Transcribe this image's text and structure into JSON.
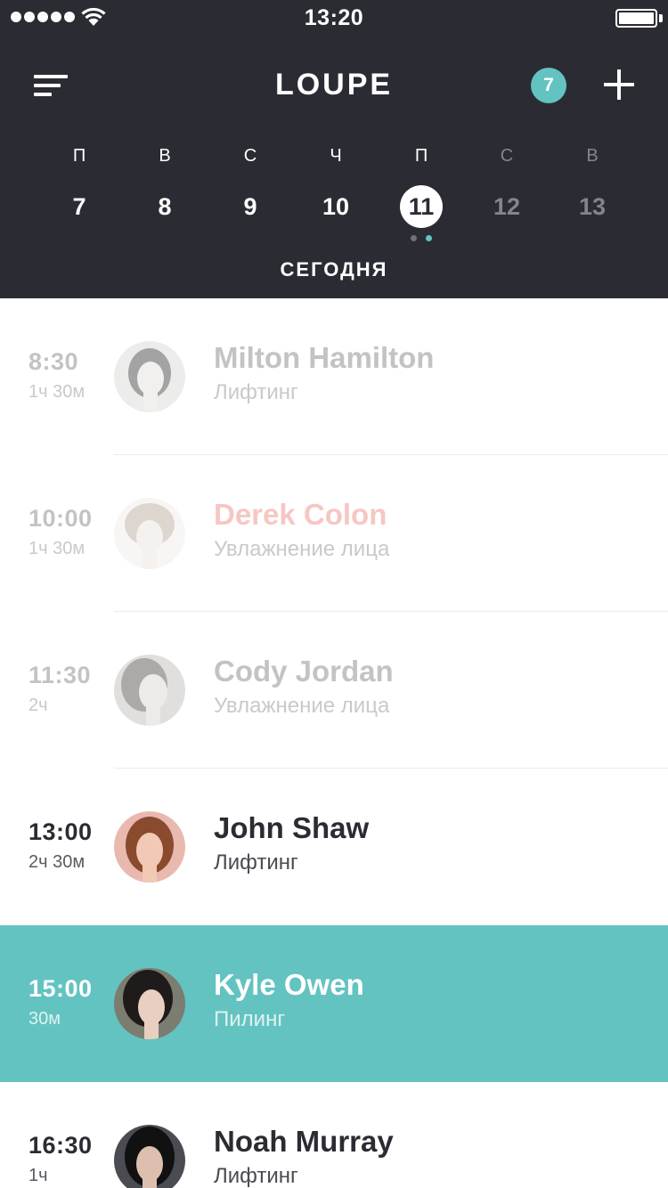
{
  "status_bar": {
    "time": "13:20"
  },
  "header": {
    "app_title": "LOUPE",
    "notification_count": "7",
    "today_label": "СЕГОДНЯ"
  },
  "week": {
    "days": [
      {
        "letter": "П",
        "number": "7"
      },
      {
        "letter": "В",
        "number": "8"
      },
      {
        "letter": "С",
        "number": "9"
      },
      {
        "letter": "Ч",
        "number": "10"
      },
      {
        "letter": "П",
        "number": "11"
      },
      {
        "letter": "С",
        "number": "12"
      },
      {
        "letter": "В",
        "number": "13"
      }
    ],
    "selected_day": "11"
  },
  "appointments": [
    {
      "time": "8:30",
      "duration": "1ч 30м",
      "name": "Milton Hamilton",
      "service": "Лифтинг",
      "state": "past"
    },
    {
      "time": "10:00",
      "duration": "1ч 30м",
      "name": "Derek Colon",
      "service": "Увлажнение лица",
      "state": "past"
    },
    {
      "time": "11:30",
      "duration": "2ч",
      "name": "Cody Jordan",
      "service": "Увлажнение лица",
      "state": "past"
    },
    {
      "time": "13:00",
      "duration": "2ч 30м",
      "name": "John Shaw",
      "service": "Лифтинг",
      "state": "upcoming"
    },
    {
      "time": "15:00",
      "duration": "30м",
      "name": "Kyle Owen",
      "service": "Пилинг",
      "state": "current"
    },
    {
      "time": "16:30",
      "duration": "1ч",
      "name": "Noah Murray",
      "service": "Лифтинг",
      "state": "upcoming"
    }
  ],
  "colors": {
    "header_bg": "#2b2c33",
    "accent": "#63c3c1",
    "dot_inactive": "#6f7079",
    "name_warning": "#f6c7c2"
  }
}
